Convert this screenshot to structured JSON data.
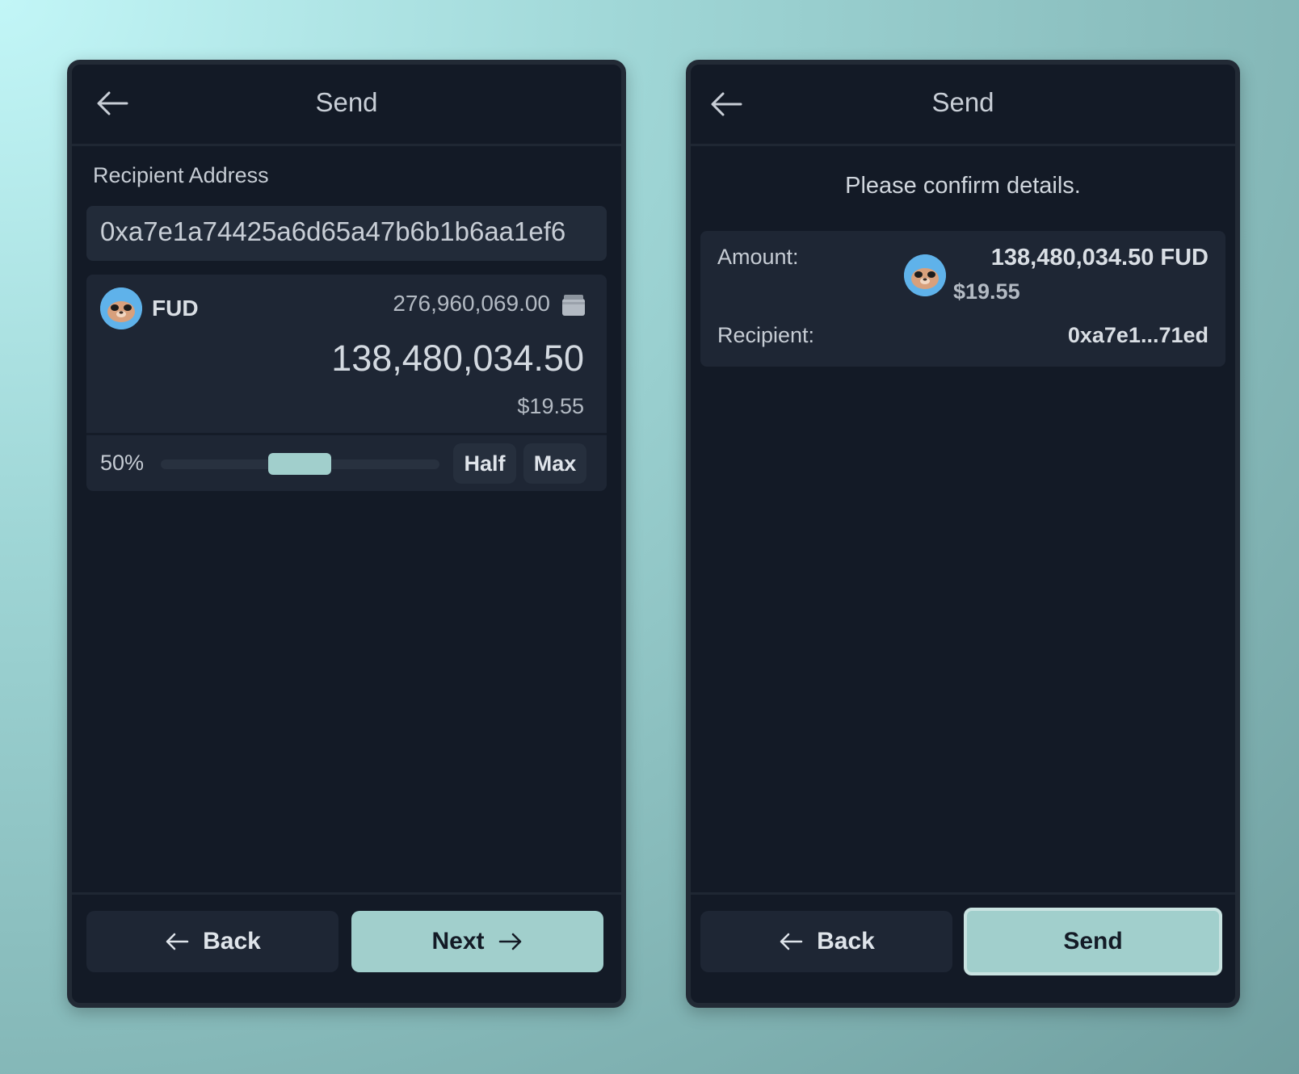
{
  "colors": {
    "accent": "#a1cfcc",
    "panel_bg": "#131a26",
    "card_bg": "#1e2634",
    "input_bg": "#222b39"
  },
  "left_screen": {
    "header": {
      "back_icon": "arrow-left-icon",
      "title": "Send"
    },
    "recipient_label": "Recipient Address",
    "recipient_value": "0xa7e1a74425a6d65a47b6b1b6aa1ef6",
    "token": {
      "avatar_icon": "fud-token-icon",
      "symbol": "FUD",
      "balance": "276,960,069.00",
      "wallet_icon": "wallet-icon",
      "amount": "138,480,034.50",
      "usd_value": "$19.55"
    },
    "slider": {
      "percent_label": "50%",
      "value": 0.5
    },
    "half_label": "Half",
    "max_label": "Max",
    "footer": {
      "back_label": "Back",
      "next_label": "Next"
    }
  },
  "right_screen": {
    "header": {
      "back_icon": "arrow-left-icon",
      "title": "Send"
    },
    "confirm_text": "Please confirm details.",
    "amount_label": "Amount:",
    "amount_value": "138,480,034.50 FUD",
    "amount_usd": "$19.55",
    "recipient_label": "Recipient:",
    "recipient_value": "0xa7e1...71ed",
    "footer": {
      "back_label": "Back",
      "send_label": "Send"
    }
  }
}
